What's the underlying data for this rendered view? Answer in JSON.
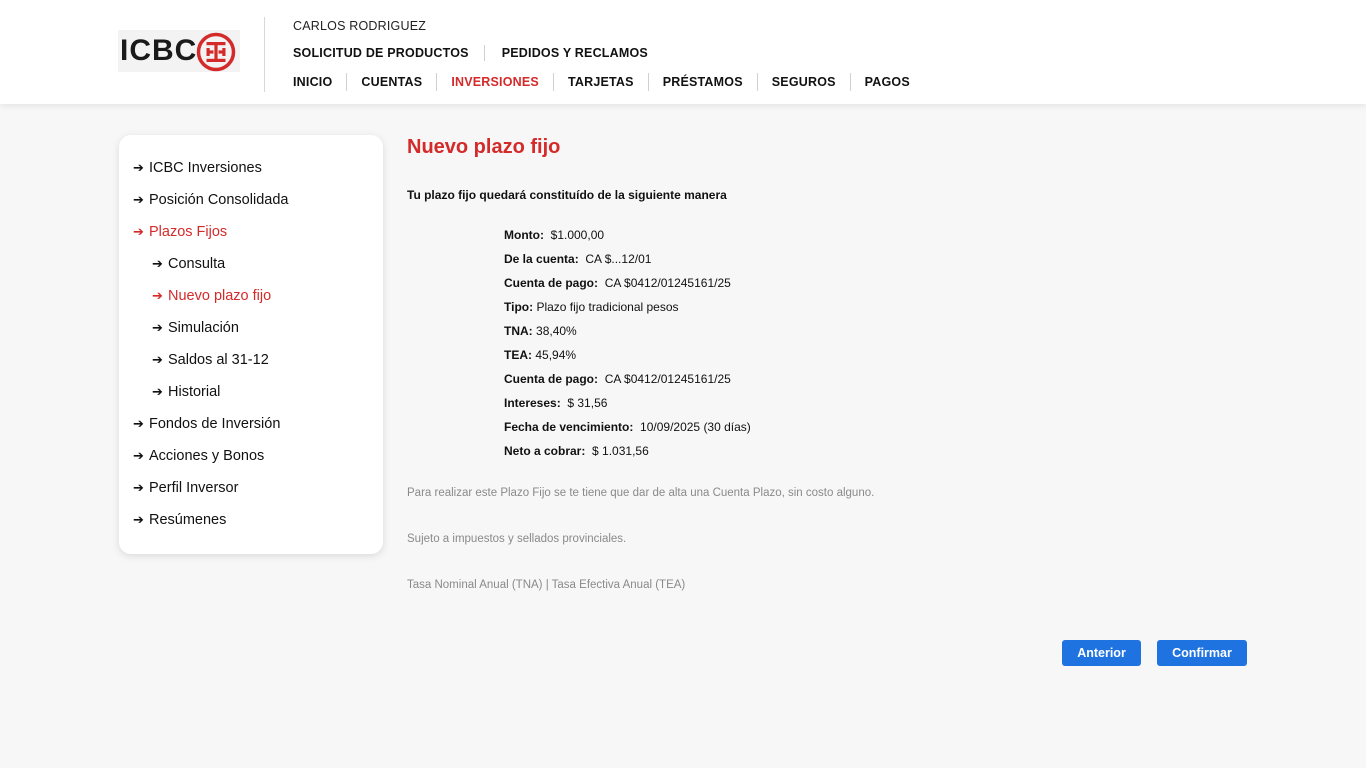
{
  "header": {
    "logo_text": "ICBC",
    "user_name": "CARLOS RODRIGUEZ",
    "top_links": [
      "SOLICITUD DE PRODUCTOS",
      "PEDIDOS Y RECLAMOS"
    ],
    "nav": [
      "INICIO",
      "CUENTAS",
      "INVERSIONES",
      "TARJETAS",
      "PRÉSTAMOS",
      "SEGUROS",
      "PAGOS"
    ],
    "active_nav": "INVERSIONES",
    "accent_color": "#d42a2a"
  },
  "sidebar": {
    "arrow_glyph": "➔",
    "items": [
      {
        "label": "ICBC Inversiones",
        "level": 0,
        "active": false
      },
      {
        "label": "Posición Consolidada",
        "level": 0,
        "active": false
      },
      {
        "label": "Plazos Fijos",
        "level": 0,
        "active": true
      },
      {
        "label": "Consulta",
        "level": 1,
        "active": false
      },
      {
        "label": "Nuevo plazo fijo",
        "level": 1,
        "active": true
      },
      {
        "label": "Simulación",
        "level": 1,
        "active": false
      },
      {
        "label": "Saldos al 31-12",
        "level": 1,
        "active": false
      },
      {
        "label": "Historial",
        "level": 1,
        "active": false
      },
      {
        "label": "Fondos de Inversión",
        "level": 0,
        "active": false
      },
      {
        "label": "Acciones y Bonos",
        "level": 0,
        "active": false
      },
      {
        "label": "Perfil Inversor",
        "level": 0,
        "active": false
      },
      {
        "label": "Resúmenes",
        "level": 0,
        "active": false
      }
    ]
  },
  "main": {
    "title": "Nuevo plazo fijo",
    "intro": "Tu plazo fijo quedará constituído de la siguiente manera",
    "details": [
      {
        "label": "Monto:",
        "value": "$1.000,00"
      },
      {
        "label": "De la cuenta:",
        "value": "CA $...12/01"
      },
      {
        "label": "Cuenta de pago:",
        "value": "CA $0412/01245161/25"
      },
      {
        "label": "Tipo:",
        "value": "Plazo fijo tradicional pesos"
      },
      {
        "label": "TNA:",
        "value": "38,40%"
      },
      {
        "label": "TEA:",
        "value": "45,94%"
      },
      {
        "label": "Cuenta de pago:",
        "value": "CA $0412/01245161/25"
      },
      {
        "label": "Intereses:",
        "value": "$ 31,56"
      },
      {
        "label": "Fecha de vencimiento:",
        "value": "10/09/2025 (30 días)"
      },
      {
        "label": "Neto a cobrar:",
        "value": "$ 1.031,56"
      }
    ],
    "notes": [
      "Para realizar este Plazo Fijo se te tiene que dar de alta una Cuenta Plazo, sin costo alguno.",
      "Sujeto a impuestos y sellados provinciales.",
      "Tasa Nominal Anual (TNA) | Tasa Efectiva Anual (TEA)"
    ],
    "buttons": {
      "previous": "Anterior",
      "confirm": "Confirmar",
      "color": "#1f73e0"
    }
  }
}
